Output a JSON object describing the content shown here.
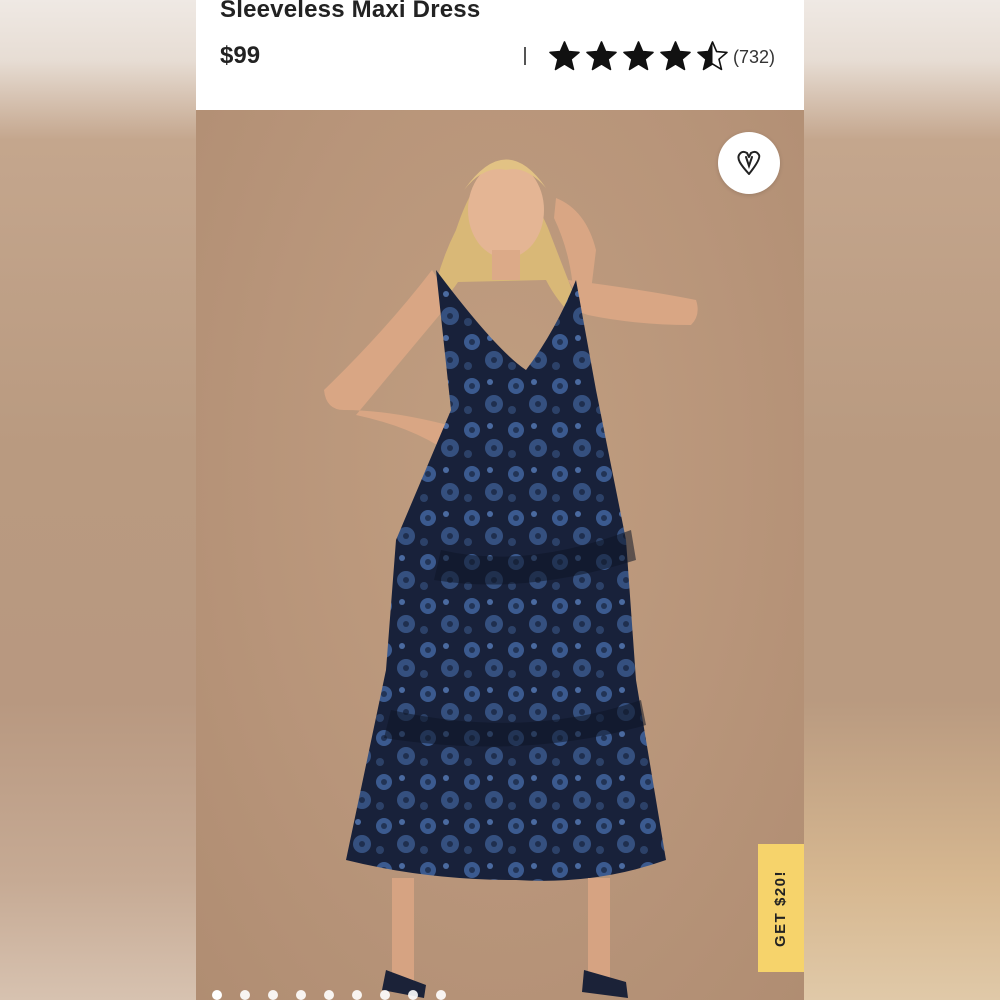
{
  "product": {
    "title": "Sleeveless Maxi Dress",
    "price": "$99",
    "rating": 4.5,
    "review_count": "(732)"
  },
  "actions": {
    "promo_label": "GET $20!"
  },
  "carousel": {
    "total_dots": 9,
    "active_index": 0
  },
  "colors": {
    "star": "#111111",
    "promo_bg": "#f6d36b",
    "backdrop": "#b8957a",
    "dress": "#1c2740",
    "dress_floral": "#3b5a8f"
  },
  "icons": {
    "favorite": "heart-icon",
    "rating": "star-icon"
  }
}
